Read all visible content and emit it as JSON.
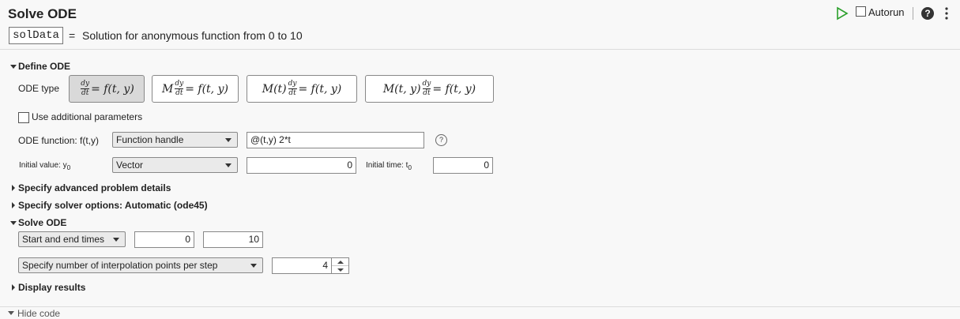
{
  "header": {
    "title": "Solve ODE",
    "output_var": "solData",
    "equals": "=",
    "summary": "Solution for anonymous function from 0 to 10"
  },
  "toolbar": {
    "run_icon": "play-icon",
    "autorun_label": "Autorun",
    "help_icon": "help-icon",
    "help_glyph": "?",
    "more_icon": "more-vert-icon"
  },
  "define": {
    "section_label": "Define ODE",
    "ode_type_label": "ODE type",
    "ode_types": [
      {
        "pre": "",
        "rhs": "= f(t, y)",
        "selected": true
      },
      {
        "pre": "M",
        "rhs": "= f(t, y)",
        "selected": false
      },
      {
        "pre": "M(t)",
        "rhs": "= f(t, y)",
        "selected": false
      },
      {
        "pre": "M(t, y)",
        "rhs": "= f(t, y)",
        "selected": false
      }
    ],
    "frac_num": "dy",
    "frac_den": "dt",
    "use_params_label": "Use additional parameters",
    "ode_function_label": "ODE function: f(t,y)",
    "ode_function_type": "Function handle",
    "ode_function_value": "@(t,y) 2*t",
    "function_help_glyph": "?",
    "initial_value_label": "Initial value: y",
    "initial_value_sub": "0",
    "initial_value_type": "Vector",
    "initial_value": "0",
    "initial_time_label": "Initial time: t",
    "initial_time_sub": "0",
    "initial_time": "0"
  },
  "sections": {
    "advanced": "Specify advanced problem details",
    "solver": "Specify solver options: Automatic (ode45)"
  },
  "solve": {
    "section_label": "Solve ODE",
    "time_mode": "Start and end times",
    "start_time": "0",
    "end_time": "10",
    "interp_mode": "Specify number of interpolation points per step",
    "interp_points": "4"
  },
  "display": {
    "section_label": "Display results"
  },
  "footer": {
    "hide_code_label": "Hide code"
  },
  "colors": {
    "run_green": "#2ca02c",
    "background": "#f8f8f8"
  }
}
